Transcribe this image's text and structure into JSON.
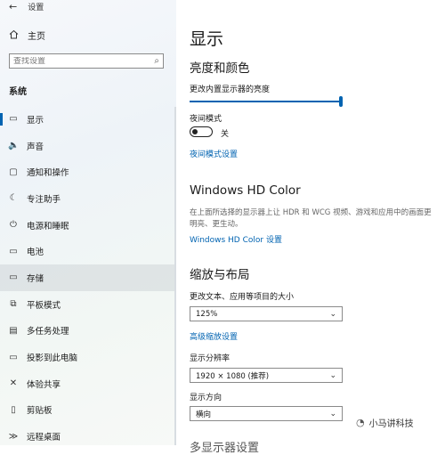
{
  "window": {
    "back_icon": "←",
    "title": "设置"
  },
  "sidebar": {
    "home_label": "主页",
    "search_placeholder": "查找设置",
    "section_title": "系统",
    "items": [
      {
        "icon": "display-icon",
        "glyph": "▭",
        "label": "显示"
      },
      {
        "icon": "sound-icon",
        "glyph": "🔈",
        "label": "声音"
      },
      {
        "icon": "notification-icon",
        "glyph": "▢",
        "label": "通知和操作"
      },
      {
        "icon": "focus-assist-icon",
        "glyph": "☾",
        "label": "专注助手"
      },
      {
        "icon": "power-icon",
        "glyph": "⏻",
        "label": "电源和睡眠"
      },
      {
        "icon": "battery-icon",
        "glyph": "▭",
        "label": "电池"
      },
      {
        "icon": "storage-icon",
        "glyph": "▭",
        "label": "存储"
      },
      {
        "icon": "tablet-mode-icon",
        "glyph": "⧉",
        "label": "平板模式"
      },
      {
        "icon": "multitasking-icon",
        "glyph": "▤",
        "label": "多任务处理"
      },
      {
        "icon": "project-icon",
        "glyph": "▭",
        "label": "投影到此电脑"
      },
      {
        "icon": "shared-experiences-icon",
        "glyph": "✕",
        "label": "体验共享"
      },
      {
        "icon": "clipboard-icon",
        "glyph": "▯",
        "label": "剪贴板"
      },
      {
        "icon": "remote-desktop-icon",
        "glyph": "≫",
        "label": "远程桌面"
      }
    ]
  },
  "main": {
    "title": "显示",
    "brightness_section": "亮度和颜色",
    "brightness_label": "更改内置显示器的亮度",
    "brightness_value": 100,
    "night_light_label": "夜间模式",
    "night_light_state": "关",
    "night_light_link": "夜间模式设置",
    "hdr_title": "Windows HD Color",
    "hdr_desc": "在上面所选择的显示器上让 HDR 和 WCG 视频、游戏和应用中的画面更明亮、更生动。",
    "hdr_link": "Windows HD Color 设置",
    "scale_section": "缩放与布局",
    "scale_label": "更改文本、应用等项目的大小",
    "scale_value": "125%",
    "advanced_scaling_link": "高级缩放设置",
    "resolution_label": "显示分辨率",
    "resolution_value": "1920 × 1080 (推荐)",
    "orientation_label": "显示方向",
    "orientation_value": "横向",
    "next_section_partial": "多显示器设置"
  },
  "watermark": {
    "text": "小马讲科技"
  }
}
